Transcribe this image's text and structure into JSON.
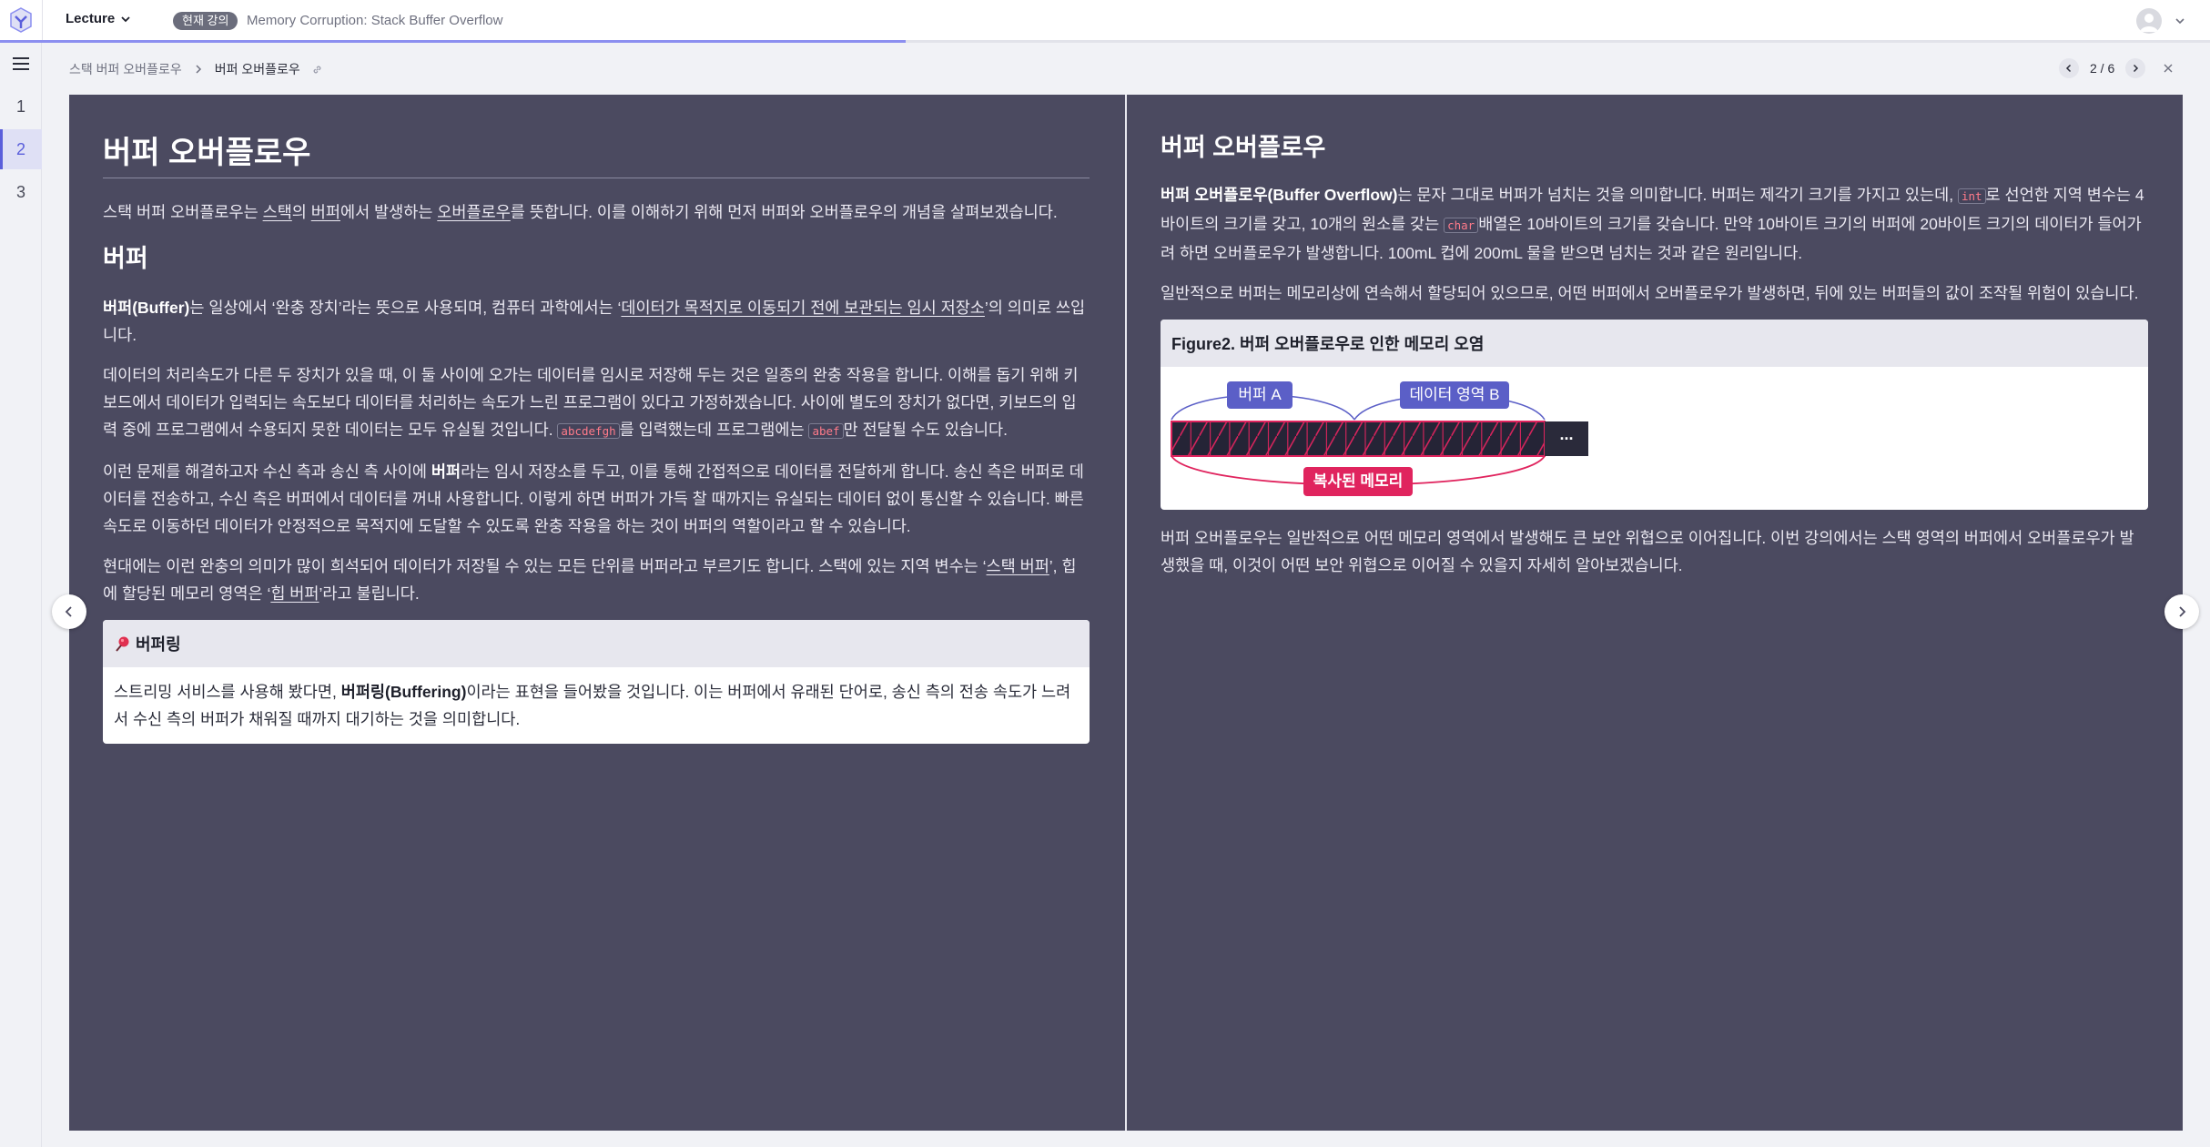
{
  "header": {
    "lecture_label": "Lecture",
    "badge": "현재 강의",
    "course_title": "Memory Corruption: Stack Buffer Overflow",
    "progress_fraction": 0.41
  },
  "rail": {
    "pages": [
      "1",
      "2",
      "3"
    ],
    "active_page": "2"
  },
  "breadcrumb": {
    "parent": "스택 버퍼 오버플로우",
    "current": "버퍼 오버플로우"
  },
  "pager": {
    "label": "2 / 6"
  },
  "left": {
    "title": "버퍼 오버플로우",
    "intro": {
      "t1": "스택 버퍼 오버플로우는 ",
      "u1": "스택",
      "t2": "의 ",
      "u2": "버퍼",
      "t3": "에서 발생하는 ",
      "u3": "오버플로우",
      "t4": "를 뜻합니다. 이를 이해하기 위해 먼저 버퍼와 오버플로우의 개념을 살펴보겠습니다."
    },
    "section_title": "버퍼",
    "p1": {
      "b1": "버퍼(Buffer)",
      "t1": "는 일상에서 ‘완충 장치’라는 뜻으로 사용되며, 컴퓨터 과학에서는 ‘",
      "u1": "데이터가 목적지로 이동되기 전에 보관되는 임시 저장소",
      "t2": "’의 의미로 쓰입니다."
    },
    "p2": {
      "t1": "데이터의 처리속도가 다른 두 장치가 있을 때, 이 둘 사이에 오가는 데이터를 임시로 저장해 두는 것은 일종의 완충 작용을 합니다. 이해를 돕기 위해 키보드에서 데이터가 입력되는 속도보다 데이터를 처리하는 속도가 느린 프로그램이 있다고 가정하겠습니다. 사이에 별도의 장치가 없다면, 키보드의 입력 중에 프로그램에서 수용되지 못한 데이터는 모두 유실될 것입니다. ",
      "c1": "abcdefgh",
      "t2": "를 입력했는데 프로그램에는 ",
      "c2": "abef",
      "t3": "만 전달될 수도 있습니다."
    },
    "p3": {
      "t1": "이런 문제를 해결하고자 수신 측과 송신 측 사이에 ",
      "b1": "버퍼",
      "t2": "라는 임시 저장소를 두고, 이를 통해 간접적으로 데이터를 전달하게 합니다. 송신 측은 버퍼로 데이터를 전송하고, 수신 측은 버퍼에서 데이터를 꺼내 사용합니다. 이렇게 하면 버퍼가 가득 찰 때까지는 유실되는 데이터 없이 통신할 수 있습니다. 빠른 속도로 이동하던 데이터가 안정적으로 목적지에 도달할 수 있도록 완충 작용을 하는 것이 버퍼의 역할이라고 할 수 있습니다."
    },
    "p4": {
      "t1": "현대에는 이런 완충의 의미가 많이 희석되어 데이터가 저장될 수 있는 모든 단위를 버퍼라고 부르기도 합니다. 스택에 있는 지역 변수는 ‘",
      "u1": "스택 버퍼",
      "t2": "’, 힙에 할당된 메모리 영역은 ‘",
      "u2": "힙 버퍼",
      "t3": "’라고 불립니다."
    },
    "callout": {
      "title": "버퍼링",
      "t1": "스트리밍 서비스를 사용해 봤다면, ",
      "b1": "버퍼링(Buffering)",
      "t2": "이라는 표현을 들어봤을 것입니다. 이는 버퍼에서 유래된 단어로, 송신 측의 전송 속도가 느려서 수신 측의 버퍼가 채워질 때까지 대기하는 것을 의미합니다."
    }
  },
  "right": {
    "title": "버퍼 오버플로우",
    "p1": {
      "b1": "버퍼 오버플로우(Buffer Overflow)",
      "t1": "는 문자 그대로 버퍼가 넘치는 것을 의미합니다. 버퍼는 제각기 크기를 가지고 있는데, ",
      "c1": "int",
      "t2": "로 선언한 지역 변수는 4바이트의 크기를 갖고, 10개의 원소를 갖는 ",
      "c2": "char",
      "t3": "배열은 10바이트의 크기를 갖습니다. 만약 10바이트 크기의 버퍼에 20바이트 크기의 데이터가 들어가려 하면 오버플로우가 발생합니다. 100mL 컵에 200mL 물을 받으면 넘치는 것과 같은 원리입니다."
    },
    "p2": "일반적으로 버퍼는 메모리상에 연속해서 할당되어 있으므로, 어떤 버퍼에서 오버플로우가 발생하면, 뒤에 있는 버퍼들의 값이 조작될 위험이 있습니다.",
    "figure": {
      "title": "Figure2. 버퍼 오버플로우로 인한 메모리 오염",
      "label_a": "버퍼 A",
      "label_b": "데이터 영역 B",
      "label_copied": "복사된 메모리",
      "ellipsis": "···"
    },
    "p3": "버퍼 오버플로우는 일반적으로 어떤 메모리 영역에서 발생해도 큰 보안 위협으로 이어집니다. 이번 강의에서는 스택 영역의 버퍼에서 오버플로우가 발생했을 때, 이것이 어떤 보안 위협으로 이어질 수 있을지 자세히 알아보겠습니다."
  },
  "colors": {
    "accent": "#5a5edb",
    "slide_bg": "#4b4a60",
    "memory_red": "#e0245e",
    "label_blue": "#5b5fc7"
  }
}
